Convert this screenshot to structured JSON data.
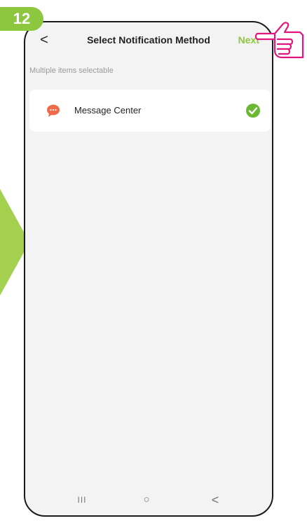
{
  "step": "12",
  "header": {
    "back_icon": "chevron-left-icon",
    "back_glyph": "<",
    "title": "Select Notification Method",
    "next_label": "Next"
  },
  "subtitle": "Multiple items selectable",
  "items": [
    {
      "label": "Message Center",
      "icon": "message-bubble-icon",
      "selected": true
    }
  ],
  "navbar": {
    "recents_glyph": "III",
    "home_glyph": "○",
    "back_glyph": "<"
  },
  "colors": {
    "accent": "#8dc63f",
    "message_icon": "#f06a4a",
    "check": "#6bb833"
  }
}
